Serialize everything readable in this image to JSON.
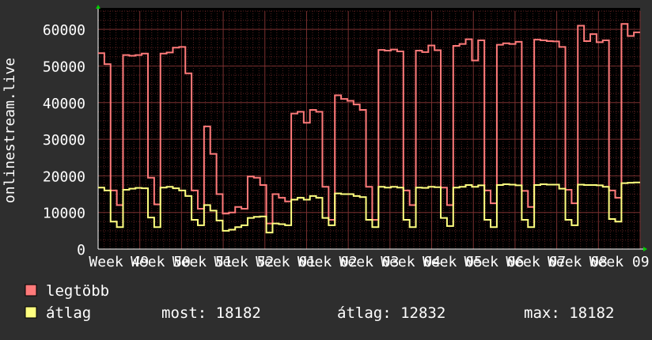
{
  "chart_data": {
    "type": "line",
    "ylabel": "onlinestream.live",
    "ylim": [
      0,
      65000
    ],
    "yticks": [
      0,
      10000,
      20000,
      30000,
      40000,
      50000,
      60000
    ],
    "grid": true,
    "categories": [
      "Week 49",
      "Week 50",
      "Week 51",
      "Week 52",
      "Week 01",
      "Week 02",
      "Week 03",
      "Week 04",
      "Week 05",
      "Week 06",
      "Week 07",
      "Week 08",
      "Week 09"
    ],
    "series": [
      {
        "name": "legtöbb",
        "color": "#ff7a7a",
        "values": [
          53500,
          50500,
          16000,
          12000,
          53000,
          52800,
          53000,
          53400,
          19500,
          12200,
          53400,
          53700,
          55000,
          55200,
          48000,
          16000,
          11000,
          33500,
          26000,
          15000,
          9700,
          10000,
          11500,
          11000,
          19800,
          19500,
          17500,
          7000,
          15000,
          14000,
          13000,
          37000,
          37500,
          34500,
          38000,
          37500,
          17000,
          8000,
          42000,
          41000,
          40500,
          39500,
          38000,
          17000,
          8000,
          54400,
          54200,
          54500,
          54000,
          16000,
          12000,
          54200,
          53800,
          55600,
          54300,
          16800,
          12000,
          55500,
          56000,
          57300,
          51500,
          57000,
          16000,
          12500,
          55800,
          56200,
          56000,
          56600,
          15900,
          11500,
          57200,
          57000,
          56800,
          56700,
          55200,
          16200,
          12500,
          61000,
          56800,
          58700,
          56500,
          57000,
          16000,
          14000,
          61500,
          58200,
          59200
        ]
      },
      {
        "name": "átlag",
        "color": "#ffff80",
        "values": [
          16800,
          16000,
          7500,
          6000,
          16200,
          16500,
          16700,
          16600,
          8600,
          6000,
          16800,
          17000,
          16600,
          16000,
          14500,
          8000,
          6500,
          12000,
          10500,
          7800,
          5000,
          5300,
          6000,
          6500,
          8500,
          8800,
          8900,
          4500,
          7000,
          6800,
          6500,
          13500,
          14000,
          13500,
          14500,
          14000,
          8500,
          6500,
          15200,
          15000,
          15000,
          14500,
          14200,
          8000,
          6000,
          17000,
          16800,
          17000,
          16800,
          8000,
          6000,
          16800,
          16700,
          17000,
          16900,
          8500,
          6300,
          16800,
          17000,
          17500,
          17000,
          17400,
          8000,
          6000,
          17500,
          17700,
          17600,
          17400,
          8000,
          6000,
          17500,
          17700,
          17600,
          17600,
          16500,
          8000,
          6500,
          17600,
          17500,
          17500,
          17400,
          17000,
          8200,
          7500,
          18000,
          18100,
          18182
        ]
      }
    ],
    "legend": "bottom",
    "stats": {
      "most_label": "most:",
      "most_value": "18182",
      "avg_label": "átlag:",
      "avg_value": "12832",
      "max_label": "max:",
      "max_value": "18182"
    }
  },
  "colors": {
    "background": "#2e2e2e",
    "plot_background": "#000000",
    "grid_minor": "#5a2020",
    "grid_major": "#7a3030",
    "text": "#ffffff",
    "arrow": "#00cc00"
  }
}
